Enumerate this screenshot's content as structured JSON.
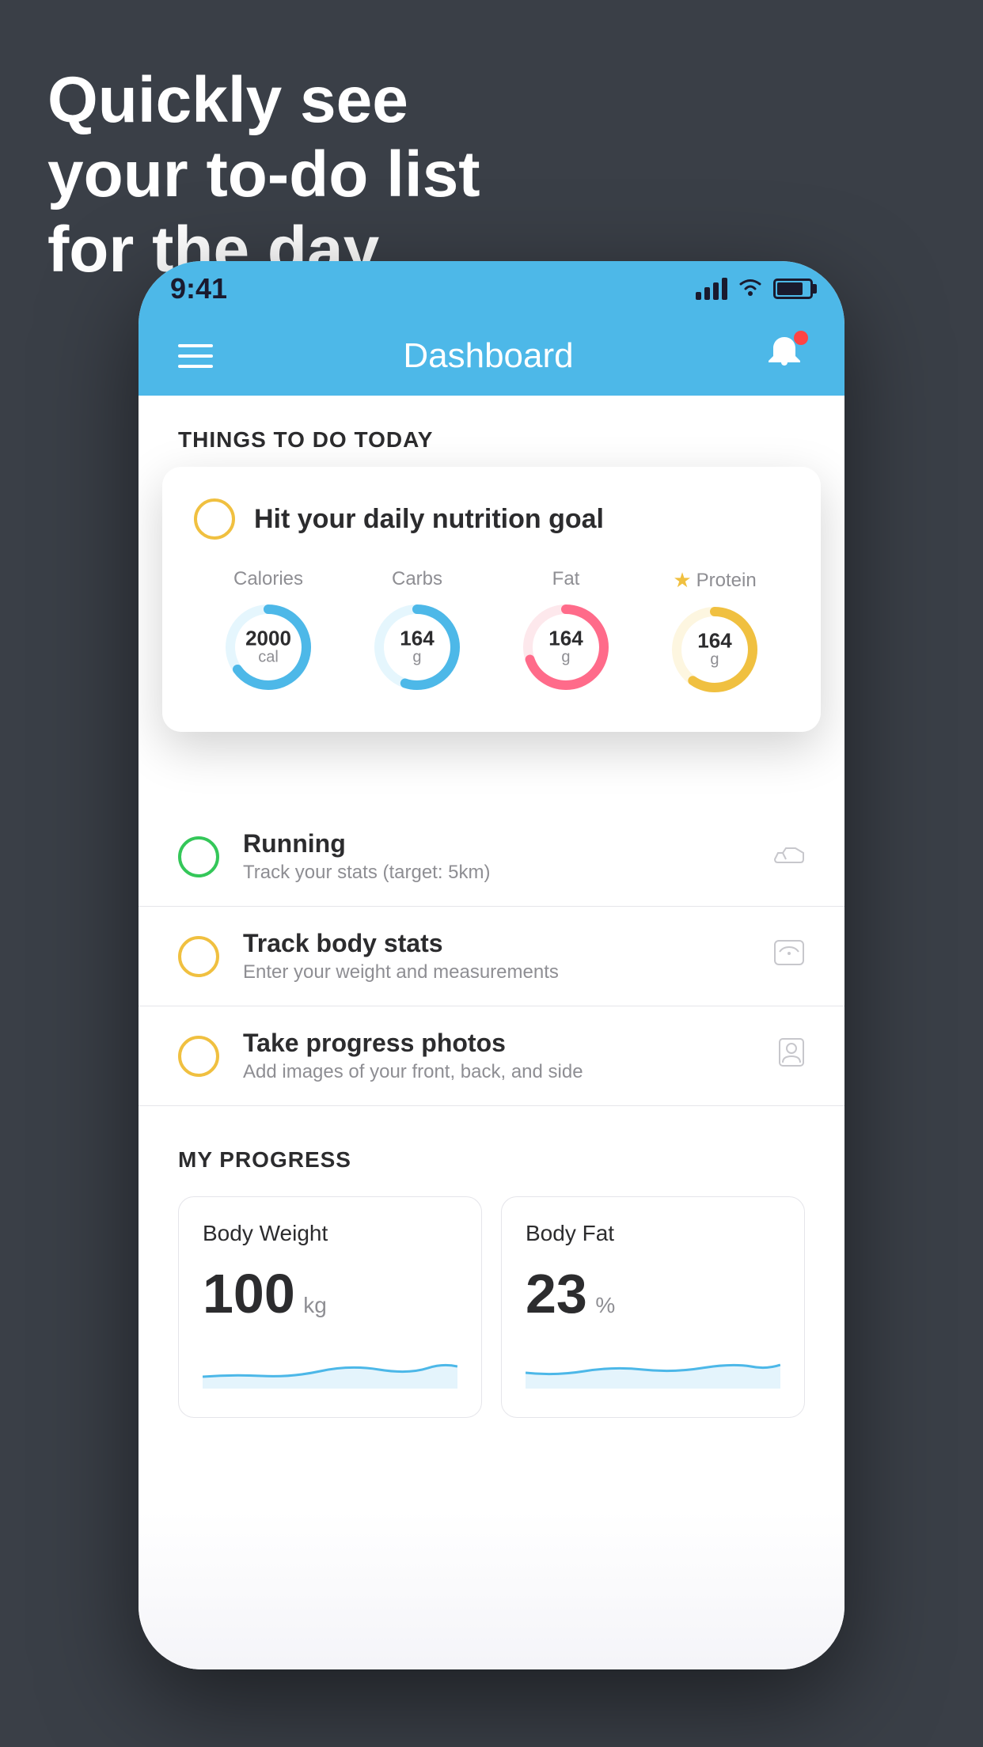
{
  "background": {
    "color": "#3a3f47"
  },
  "headline": {
    "line1": "Quickly see",
    "line2": "your to-do list",
    "line3": "for the day."
  },
  "status_bar": {
    "time": "9:41",
    "color": "#4db8e8"
  },
  "nav": {
    "title": "Dashboard"
  },
  "things_section": {
    "title": "THINGS TO DO TODAY"
  },
  "floating_card": {
    "title": "Hit your daily nutrition goal",
    "circle_color": "#f0c040",
    "nutrition": [
      {
        "label": "Calories",
        "value": "2000",
        "unit": "cal",
        "color": "#4db8e8",
        "track_color": "#e5f6fd",
        "progress": 0.65
      },
      {
        "label": "Carbs",
        "value": "164",
        "unit": "g",
        "color": "#4db8e8",
        "track_color": "#e5f6fd",
        "progress": 0.55
      },
      {
        "label": "Fat",
        "value": "164",
        "unit": "g",
        "color": "#ff6b8a",
        "track_color": "#fde8ec",
        "progress": 0.7
      },
      {
        "label": "Protein",
        "value": "164",
        "unit": "g",
        "color": "#f0c040",
        "track_color": "#fdf6e0",
        "progress": 0.6,
        "star": true
      }
    ]
  },
  "list_items": [
    {
      "title": "Running",
      "subtitle": "Track your stats (target: 5km)",
      "circle_color": "green",
      "icon": "shoe"
    },
    {
      "title": "Track body stats",
      "subtitle": "Enter your weight and measurements",
      "circle_color": "yellow",
      "icon": "scale"
    },
    {
      "title": "Take progress photos",
      "subtitle": "Add images of your front, back, and side",
      "circle_color": "yellow",
      "icon": "person"
    }
  ],
  "progress_section": {
    "title": "MY PROGRESS",
    "cards": [
      {
        "title": "Body Weight",
        "value": "100",
        "unit": "kg"
      },
      {
        "title": "Body Fat",
        "value": "23",
        "unit": "%"
      }
    ]
  }
}
